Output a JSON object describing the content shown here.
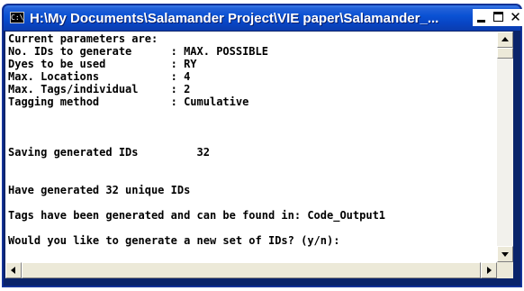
{
  "window": {
    "title": "H:\\My Documents\\Salamander Project\\VIE paper\\Salamander_...",
    "icon_text": "C:\\",
    "buttons": {
      "minimize": "minimize",
      "maximize": "maximize",
      "close": "✕"
    }
  },
  "console": {
    "lines": [
      "Current parameters are:",
      "No. IDs to generate      : MAX. POSSIBLE",
      "Dyes to be used          : RY",
      "Max. Locations           : 4",
      "Max. Tags/individual     : 2",
      "Tagging method           : Cumulative",
      "",
      "",
      "",
      "Saving generated IDs         32",
      "",
      "",
      "Have generated 32 unique IDs",
      "",
      "Tags have been generated and can be found in: Code_Output1",
      "",
      "Would you like to generate a new set of IDs? (y/n):"
    ]
  },
  "colors": {
    "titlebar": "#0a52d4",
    "console_bg": "#ffffff",
    "console_text": "#000000",
    "scrollbar": "#ece9d8"
  }
}
